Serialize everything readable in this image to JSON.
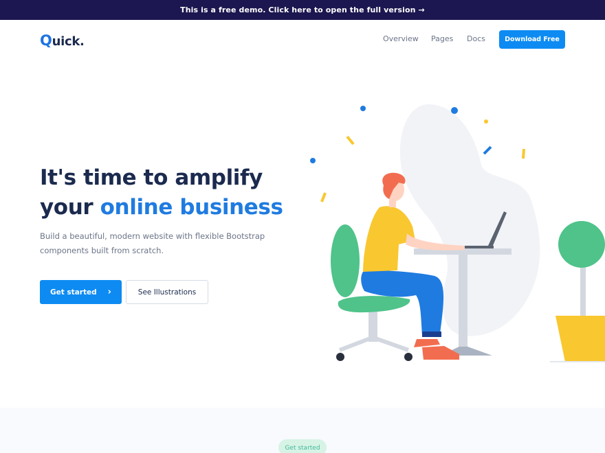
{
  "banner": {
    "text": "This is a free demo. Click here to open the full version",
    "arrow": "→"
  },
  "navbar": {
    "logo_initial": "Q",
    "logo_rest": "uick.",
    "links": [
      "Overview",
      "Pages",
      "Docs"
    ],
    "cta_label": "Download Free"
  },
  "hero": {
    "title_line1": "It's time to amplify",
    "title_line2_plain": "your ",
    "title_line2_accent": "online business",
    "subtitle": "Build a beautiful, modern website with flexible Bootstrap components built from scratch.",
    "primary_button": "Get started",
    "primary_button_icon": "chevron-right-icon",
    "secondary_button": "See Illustrations"
  },
  "next_section": {
    "badge": "Get started"
  },
  "colors": {
    "brand_blue": "#0d8bf2",
    "accent_text": "#1f7be0",
    "banner_bg": "#1c1750",
    "heading": "#1b2a4e",
    "muted": "#6b7488",
    "badge_bg": "#d6f3e6",
    "badge_text": "#42ba96"
  }
}
